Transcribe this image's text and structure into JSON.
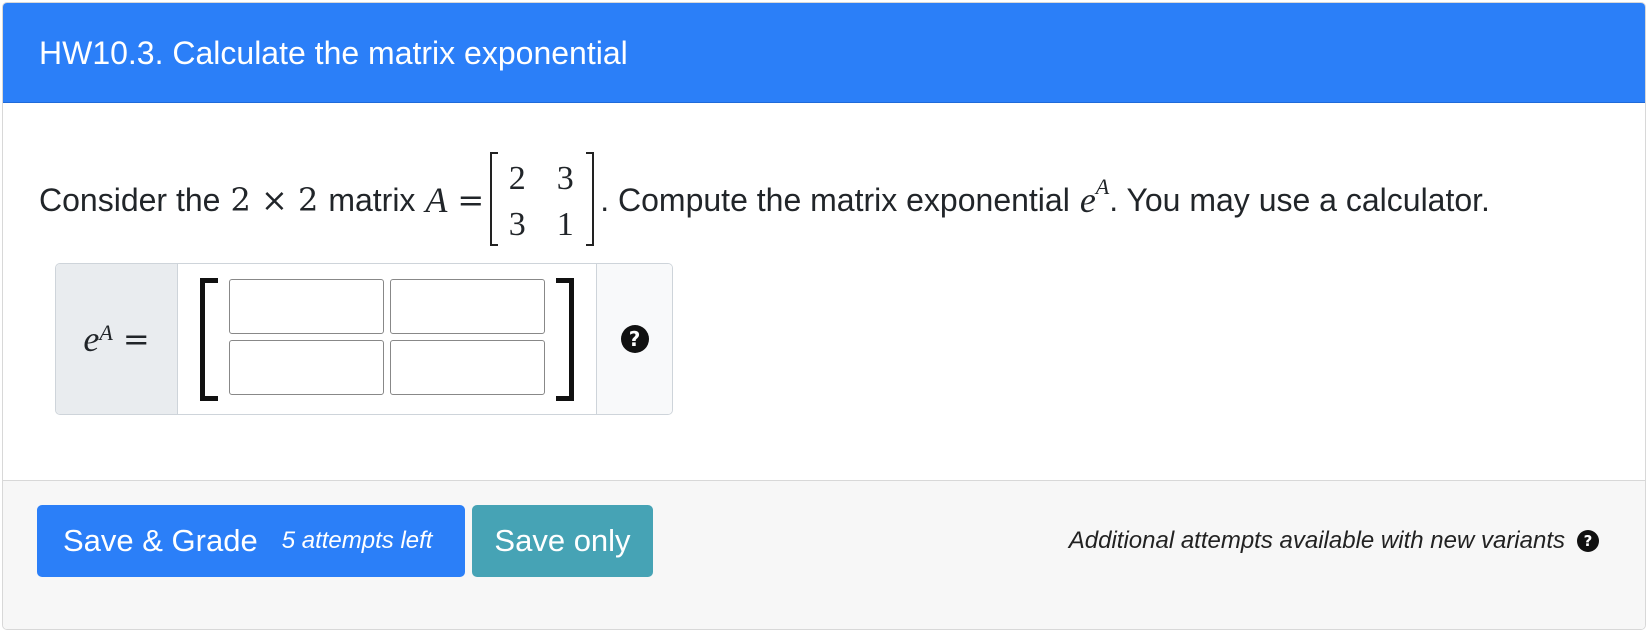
{
  "header": {
    "title": "HW10.3. Calculate the matrix exponential"
  },
  "question": {
    "text_before": "Consider the",
    "dims": "2 × 2",
    "text_matrix": "matrix",
    "var": "A",
    "equals": "=",
    "matrix": [
      [
        "2",
        "3"
      ],
      [
        "3",
        "1"
      ]
    ],
    "text_after": ". Compute the matrix exponential",
    "exp_base": "e",
    "exp_sup": "A",
    "text_end": ". You may use a calculator."
  },
  "answer": {
    "label_base": "e",
    "label_sup": "A",
    "label_eq": "=",
    "cells": [
      [
        "",
        ""
      ],
      [
        "",
        ""
      ]
    ],
    "help_icon": "question-circle-icon"
  },
  "footer": {
    "grade_label": "Save & Grade",
    "attempts": "5 attempts left",
    "save_label": "Save only",
    "note": "Additional attempts available with new variants"
  },
  "colors": {
    "header_bg": "#2b7ff8",
    "grade_btn": "#2b7ff8",
    "save_btn": "#46a3b5"
  }
}
